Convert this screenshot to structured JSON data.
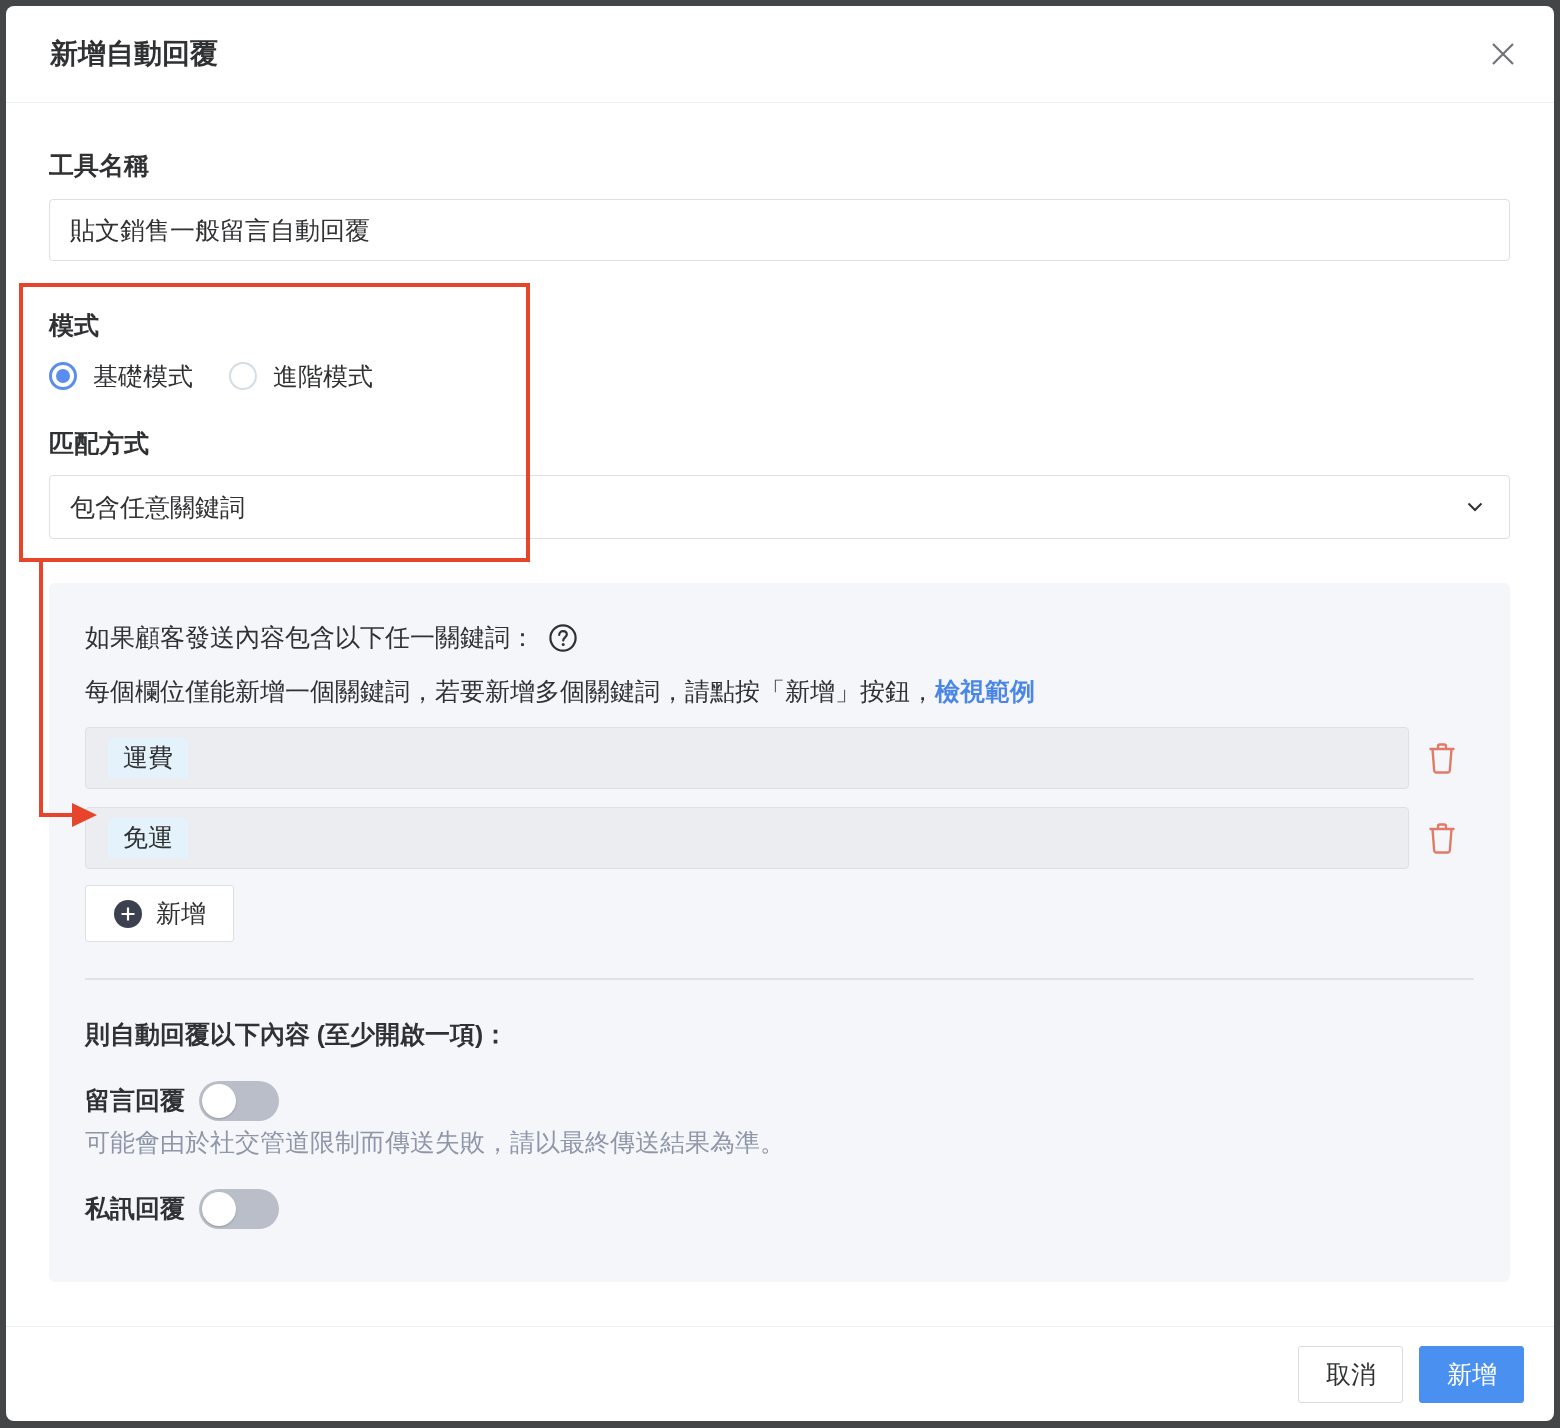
{
  "dialog": {
    "title": "新增自動回覆"
  },
  "tool_name": {
    "label": "工具名稱",
    "value": "貼文銷售一般留言自動回覆"
  },
  "mode": {
    "label": "模式",
    "options": [
      {
        "label": "基礎模式",
        "selected": true
      },
      {
        "label": "進階模式",
        "selected": false
      }
    ]
  },
  "match": {
    "label": "匹配方式",
    "value": "包含任意關鍵詞"
  },
  "keywords_panel": {
    "condition": "如果顧客發送內容包含以下任一關鍵詞：",
    "hint": "每個欄位僅能新增一個關鍵詞，若要新增多個關鍵詞，請點按「新增」按鈕，",
    "hint_link": "檢視範例",
    "keywords": [
      "運費",
      "免運"
    ],
    "add_button": "新增"
  },
  "replies": {
    "heading": "則自動回覆以下內容 (至少開啟一項)：",
    "options": [
      {
        "label": "留言回覆",
        "on": false,
        "note": "可能會由於社交管道限制而傳送失敗，請以最終傳送結果為準。"
      },
      {
        "label": "私訊回覆",
        "on": false
      }
    ]
  },
  "footer": {
    "buttons": [
      {
        "label": "取消",
        "kind": "secondary"
      },
      {
        "label": "新增",
        "kind": "primary"
      }
    ]
  }
}
